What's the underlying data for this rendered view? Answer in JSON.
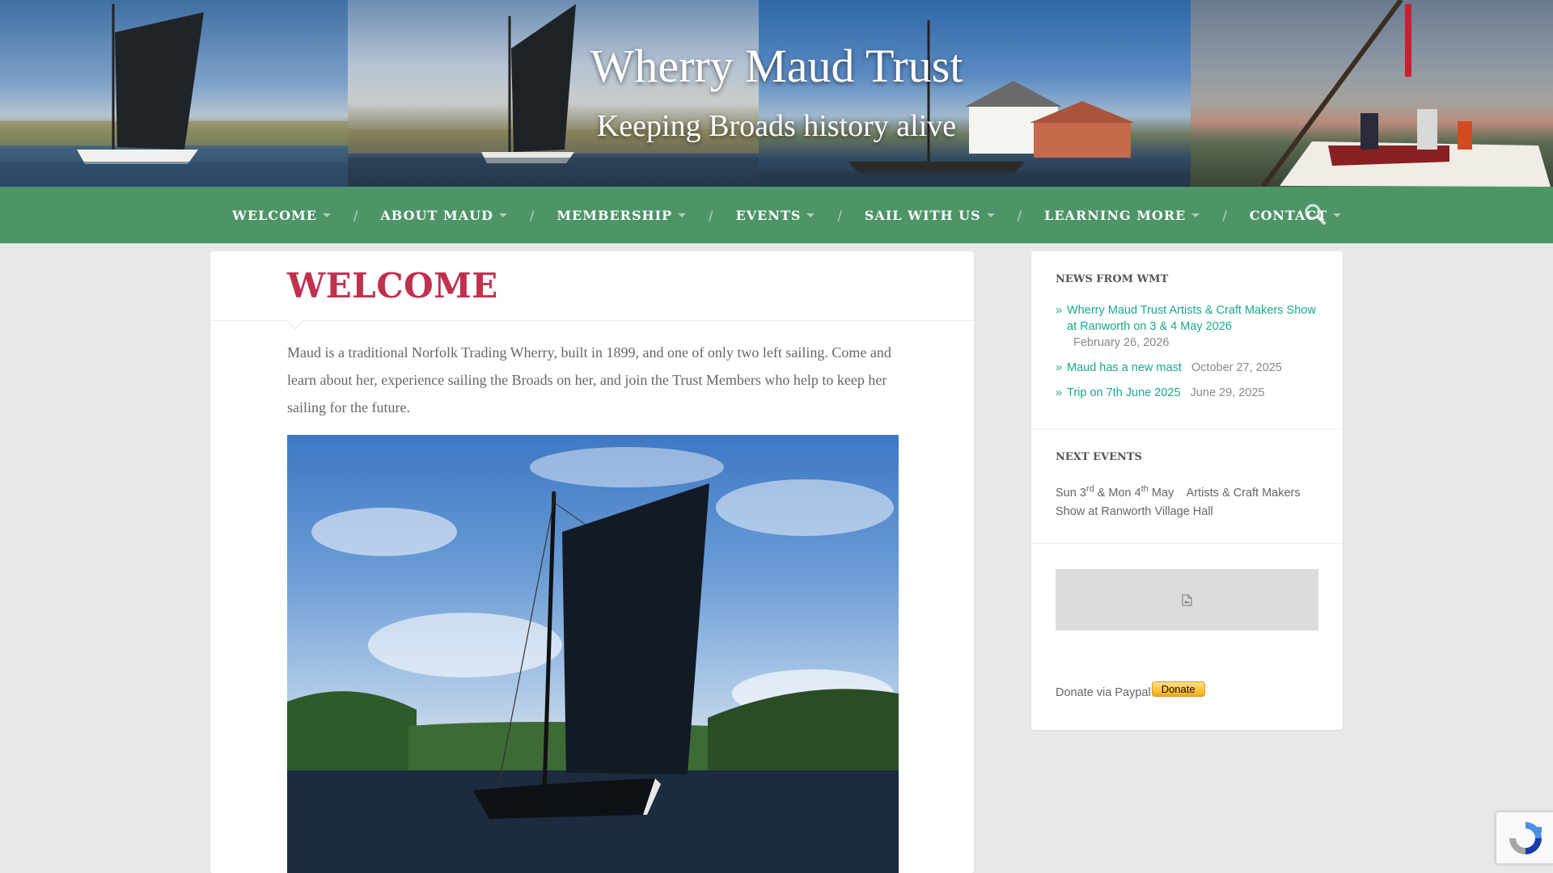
{
  "header": {
    "title": "Wherry Maud Trust",
    "tagline": "Keeping Broads history alive"
  },
  "nav": {
    "items": [
      {
        "label": "WELCOME"
      },
      {
        "label": "ABOUT MAUD"
      },
      {
        "label": "MEMBERSHIP"
      },
      {
        "label": "EVENTS"
      },
      {
        "label": "SAIL WITH US"
      },
      {
        "label": "LEARNING MORE"
      },
      {
        "label": "CONTACT"
      }
    ],
    "separator": "/",
    "search_icon": "search-icon"
  },
  "main": {
    "title": "WELCOME",
    "intro": "Maud is a traditional Norfolk Trading Wherry, built in 1899, and one of only two left sailing. Come and learn about her, experience sailing the Broads on her, and join the Trust Members who help to keep her sailing for the future."
  },
  "sidebar": {
    "news_title": "NEWS FROM WMT",
    "news": [
      {
        "title": "Wherry Maud Trust Artists & Craft Makers Show at Ranworth on 3 & 4 May 2026",
        "date": "February 26, 2026"
      },
      {
        "title": "Maud has a new mast",
        "date": "October 27, 2025"
      },
      {
        "title": "Trip on 7th June 2025",
        "date": "June 29, 2025"
      }
    ],
    "bullet": "»",
    "events_title": "NEXT EVENTS",
    "events": {
      "part1": "Sun 3",
      "sup1": "rd",
      "part2": " & Mon 4",
      "sup2": "th",
      "part3": " May    Artists & Craft Makers Show at Ranworth Village Hall"
    },
    "donate_text": "Donate via Paypal",
    "donate_button": "Donate"
  },
  "colors": {
    "nav_bg": "#4d9467",
    "title_red": "#c0304f",
    "link_teal": "#17a98d"
  }
}
